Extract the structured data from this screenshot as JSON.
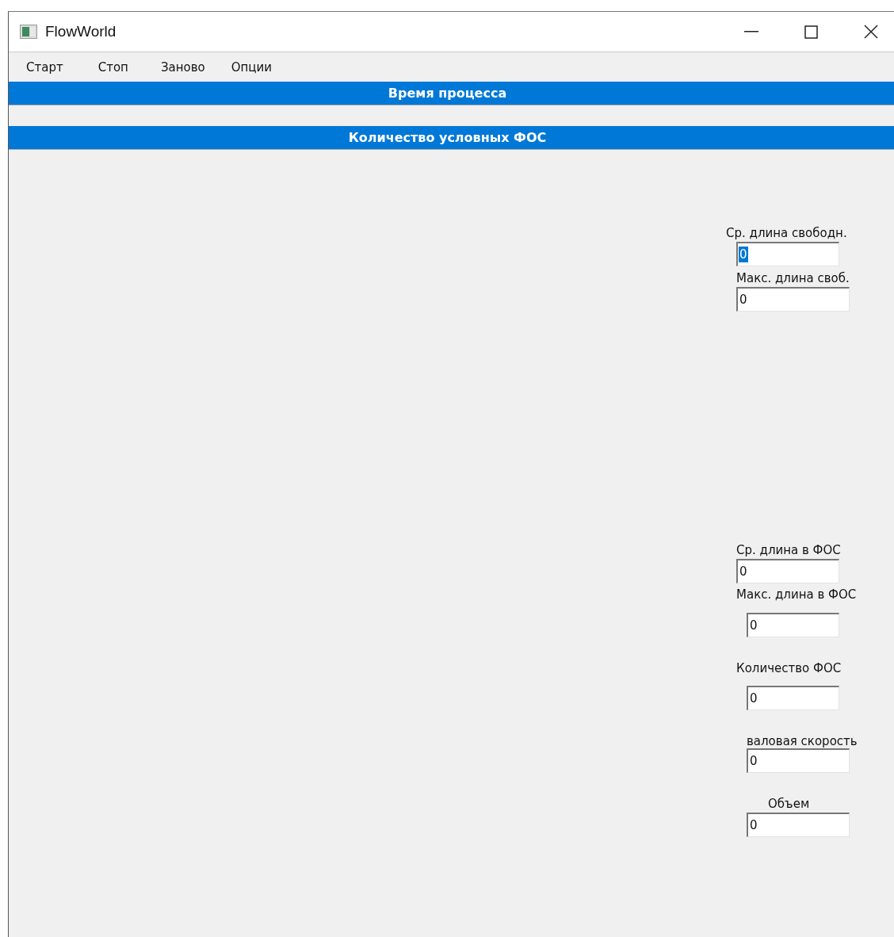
{
  "window": {
    "title": "FlowWorld"
  },
  "menu": [
    "Старт",
    "Стоп",
    "Заново",
    "Опции"
  ],
  "header_bars": [
    {
      "label": "Время процесса"
    },
    {
      "label": "Количество условных ФОС"
    }
  ],
  "fields": [
    {
      "label": "Ср. длина свободн.",
      "value": "0",
      "focused": true
    },
    {
      "label": "Макс. длина своб.",
      "value": "0",
      "focused": false
    },
    {
      "label": "Ср. длина в ФОС",
      "value": "0",
      "focused": false
    },
    {
      "label": "Макс. длина в ФОС",
      "value": "0",
      "focused": false
    },
    {
      "label": "Количество ФОС",
      "value": "0",
      "focused": false
    },
    {
      "label": "валовая скорость",
      "value": "0",
      "focused": false
    },
    {
      "label": "Объем",
      "value": "0",
      "focused": false
    }
  ]
}
